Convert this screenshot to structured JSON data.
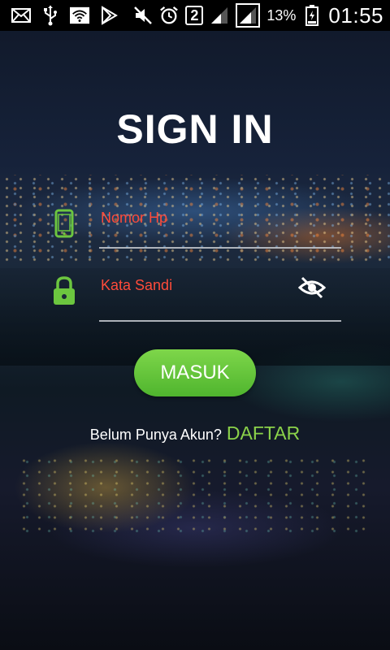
{
  "status_bar": {
    "notification_icons": [
      "email-icon",
      "usb-icon",
      "wifi-hotspot-icon",
      "play-store-icon"
    ],
    "muted_icon": "mute-icon",
    "alarm_icon": "alarm-icon",
    "sim_badge": "2",
    "battery_percent": "13%",
    "time": "01:55"
  },
  "page": {
    "title": "SIGN IN"
  },
  "form": {
    "phone": {
      "placeholder": "Nomor Hp",
      "icon": "phone-icon"
    },
    "password": {
      "placeholder": "Kata Sandi",
      "icon": "lock-icon",
      "toggle_icon": "eye-off-icon"
    },
    "submit_label": "MASUK"
  },
  "signup": {
    "prompt": "Belum Punya Akun?",
    "link": "DAFTAR"
  },
  "colors": {
    "accent_green": "#6cc63f",
    "placeholder_red": "#ff4b3a",
    "link_green": "#8bd24a"
  }
}
